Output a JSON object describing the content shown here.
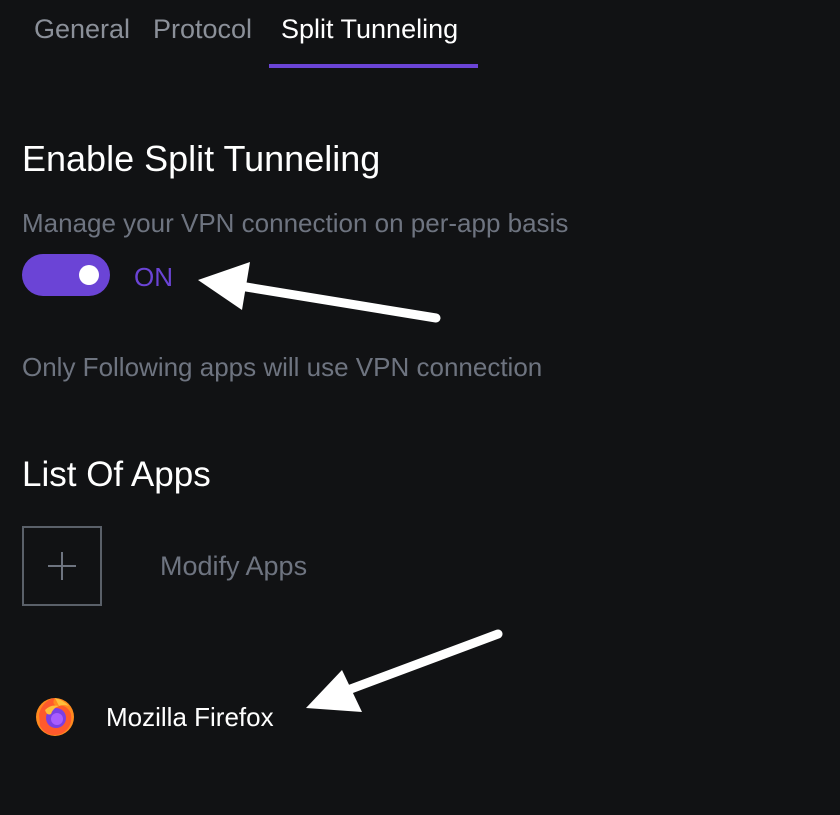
{
  "tabs": [
    {
      "label": "General"
    },
    {
      "label": "Protocol"
    },
    {
      "label": "Split Tunneling",
      "active": true
    }
  ],
  "split_tunneling": {
    "title": "Enable Split Tunneling",
    "description": "Manage your VPN connection on per-app basis",
    "toggle_state": "ON",
    "note": "Only Following apps will use VPN connection"
  },
  "apps": {
    "title": "List Of Apps",
    "add_icon": "plus-icon",
    "modify_label": "Modify Apps",
    "items": [
      {
        "name": "Mozilla Firefox",
        "icon": "firefox-icon"
      }
    ]
  },
  "colors": {
    "background": "#111214",
    "accent": "#6b44d6",
    "muted_text": "#6e7480",
    "tab_inactive": "#8b9099",
    "text": "#ffffff"
  }
}
